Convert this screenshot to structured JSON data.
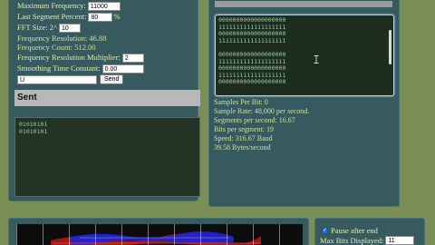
{
  "settings": {
    "max_frequency": {
      "label": "Maximum Frequency:",
      "value": "11000"
    },
    "last_segment_percent": {
      "label": "Last Segment Percent:",
      "value": "80",
      "suffix": "%"
    },
    "fft_size": {
      "label": "FFT Size: 2^",
      "value": "10"
    },
    "frequency_resolution": "Frequency Resolution: 46.88",
    "frequency_count": "Frequency Count: 512.00",
    "resolution_multiplier": {
      "label": "Frequency Resolution Multiplier:",
      "value": "2"
    },
    "smoothing": {
      "label": "Smoothing Time Constant:",
      "value": "0.00"
    }
  },
  "message": {
    "value": "U",
    "send_label": "Send"
  },
  "sent": {
    "title": "Sent",
    "lines": [
      "01010101",
      "01010101"
    ]
  },
  "received_bits": {
    "lines": [
      "0000000000000000000",
      "1111111111111111111",
      "0000000000000000000",
      "1111111111111111111",
      "",
      "0000000000000000000",
      "1111111111111111111",
      "0000000000000000000",
      "1111111111111111111",
      "0000000000000000000"
    ]
  },
  "stats": {
    "samples_per_bit": "Samples Per Bit: 0",
    "sample_rate": "Sample Rate: 48,000 per second.",
    "segments_per_second": "Segments per second: 16.67",
    "bits_per_segment": "Bits per segment: 19",
    "speed": "Speed: 316.67 Baud",
    "bytes_per_second": "39.58 Bytes/second"
  },
  "options": {
    "pause_after_end": {
      "label": "Pause after end",
      "checked": true
    },
    "max_bits": {
      "label": "Max Bits Displayed:",
      "value": "11"
    }
  },
  "icons": {
    "checkbox": "check-icon",
    "cursor": "text-cursor-icon",
    "spectrogram": "spectrogram-image"
  },
  "colors": {
    "panel": "#365a5e",
    "background": "#7a8f56",
    "text": "#d8e8b0",
    "spectrum_red": "#c02020",
    "spectrum_blue": "#2a2ad0"
  }
}
